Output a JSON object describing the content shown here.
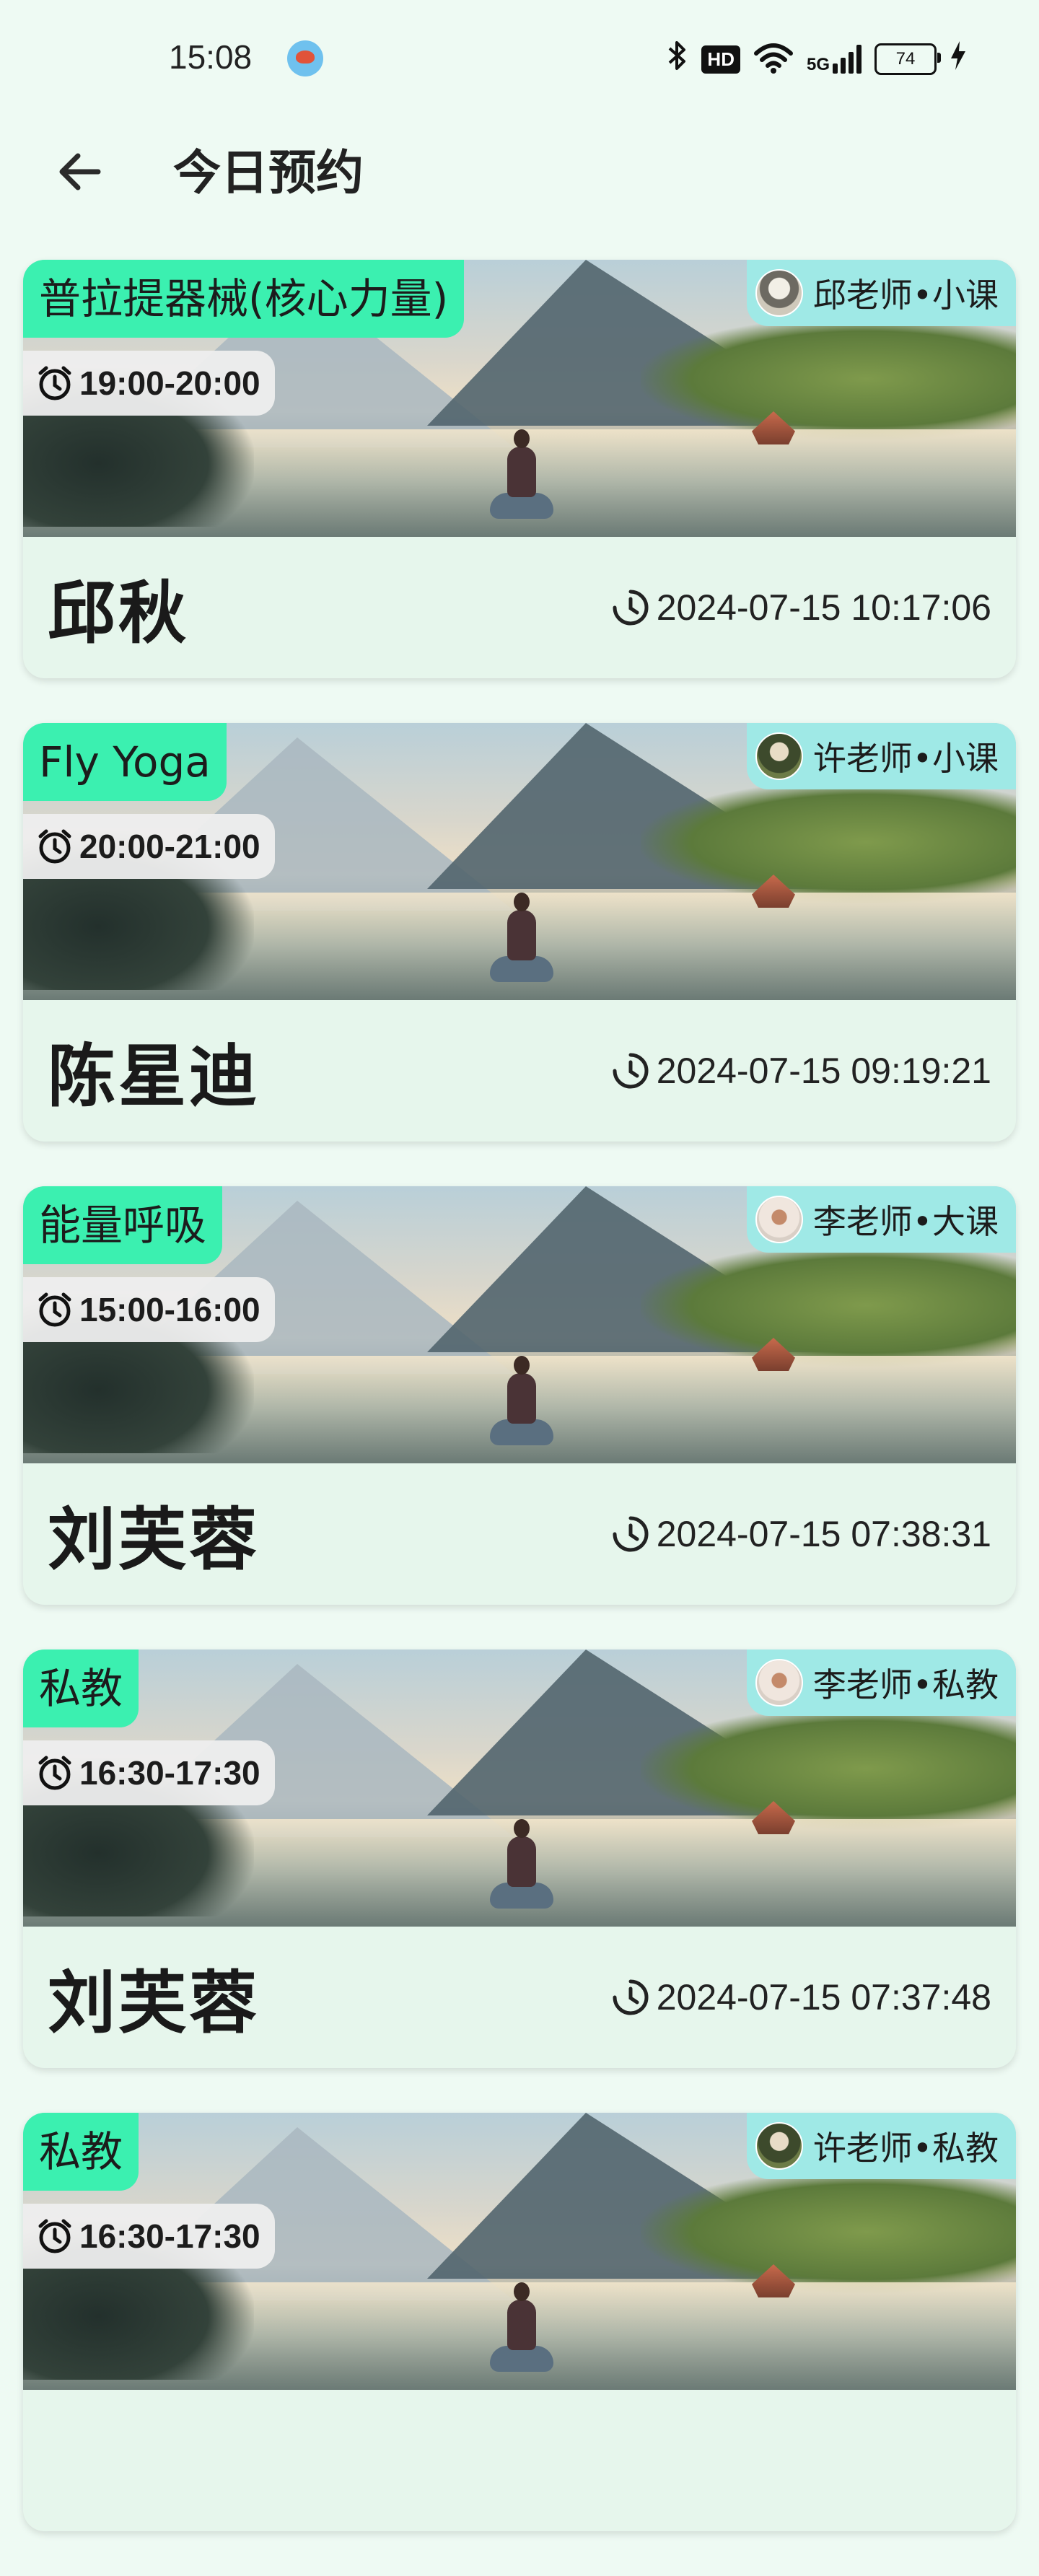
{
  "status_bar": {
    "time": "15:08",
    "hd_label": "HD",
    "network_label": "5G",
    "battery_level": "74"
  },
  "header": {
    "title": "今日预约"
  },
  "bookings": [
    {
      "course": "普拉提器械(核心力量)",
      "teacher": "邱老师•小课",
      "time_range": "19:00-20:00",
      "student": "邱秋",
      "booked_at": "2024-07-15 10:17:06"
    },
    {
      "course": "Fly Yoga",
      "teacher": "许老师•小课",
      "time_range": "20:00-21:00",
      "student": "陈星迪",
      "booked_at": "2024-07-15 09:19:21"
    },
    {
      "course": "能量呼吸",
      "teacher": "李老师•大课",
      "time_range": "15:00-16:00",
      "student": "刘芙蓉",
      "booked_at": "2024-07-15 07:38:31"
    },
    {
      "course": "私教",
      "teacher": "李老师•私教",
      "time_range": "16:30-17:30",
      "student": "刘芙蓉",
      "booked_at": "2024-07-15 07:37:48"
    },
    {
      "course": "私教",
      "teacher": "许老师•私教",
      "time_range": "16:30-17:30",
      "student": "",
      "booked_at": ""
    }
  ],
  "colors": {
    "background": "#eefaf3",
    "course_tag": "#3bf0b0",
    "teacher_tag": "#9fe9e6"
  }
}
